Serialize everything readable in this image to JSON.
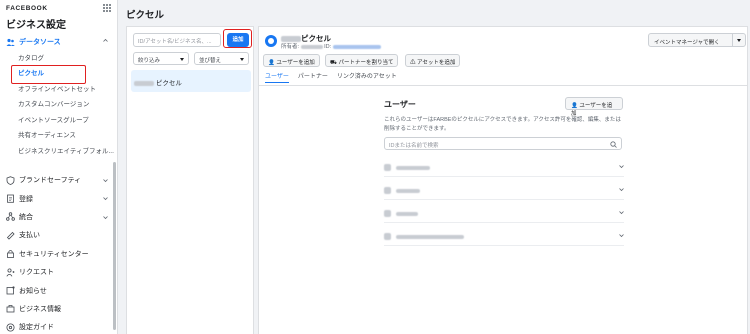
{
  "sidebar": {
    "brand": "FACEBOOK",
    "title": "ビジネス設定",
    "data_sources": {
      "label": "データソース",
      "items": [
        {
          "label": "カタログ"
        },
        {
          "label": "ピクセル"
        },
        {
          "label": "オフラインイベントセット"
        },
        {
          "label": "カスタムコンバージョン"
        },
        {
          "label": "イベントソースグループ"
        },
        {
          "label": "共有オーディエンス"
        },
        {
          "label": "ビジネスクリエイティブフォル..."
        }
      ]
    },
    "groups": [
      {
        "label": "ブランドセーフティ",
        "icon": "shield-icon"
      },
      {
        "label": "登録",
        "icon": "registration-icon"
      },
      {
        "label": "統合",
        "icon": "integrations-icon"
      },
      {
        "label": "支払い",
        "icon": "payments-icon"
      },
      {
        "label": "セキュリティセンター",
        "icon": "lock-icon"
      },
      {
        "label": "リクエスト",
        "icon": "request-icon"
      },
      {
        "label": "お知らせ",
        "icon": "notification-icon"
      },
      {
        "label": "ビジネス情報",
        "icon": "business-info-icon"
      },
      {
        "label": "設定ガイド",
        "icon": "settings-guide-icon"
      }
    ]
  },
  "page": {
    "title": "ピクセル"
  },
  "list": {
    "search_placeholder": "ID/アセット名/ビジネス名、...",
    "add_button": "追加",
    "filter_label": "絞り込み",
    "sort_label": "並び替え",
    "selected_asset": "ピクセル"
  },
  "detail": {
    "pixel_name": "ピクセル",
    "owner_prefix": "所有者:",
    "id_prefix": "ID:",
    "event_manager_button": "イベントマネージャで開く",
    "actions": {
      "add_user": "ユーザーを追加",
      "assign_partner": "パートナーを割り当て",
      "add_assets": "アセットを追加"
    },
    "tabs": [
      "ユーザー",
      "パートナー",
      "リンク済みのアセット"
    ],
    "users": {
      "title": "ユーザー",
      "add_button": "ユーザーを追加",
      "description": "これらのユーザーはFARBEのピクセルにアクセスできます。アクセス許可を確認、編集、または削除することができます。",
      "search_placeholder": "IDまたは名前で検索"
    }
  },
  "colors": {
    "accent": "#1877f2",
    "highlight": "#e02020",
    "selected_bg": "#e7f3ff"
  }
}
